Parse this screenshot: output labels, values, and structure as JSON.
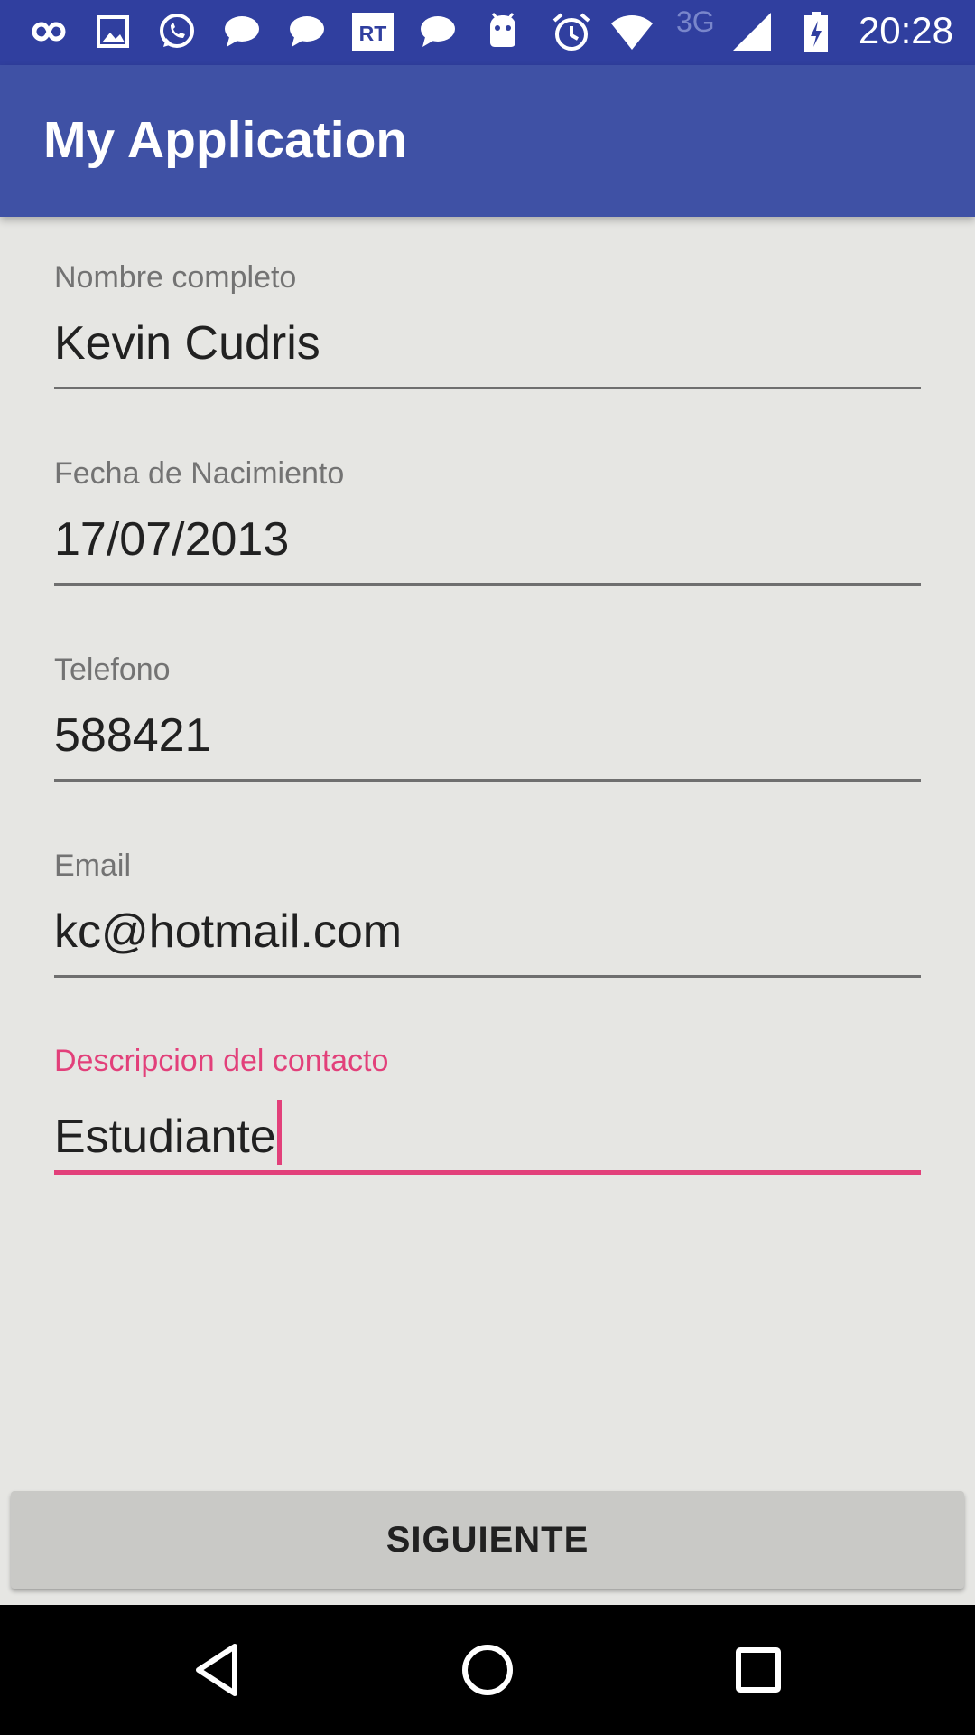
{
  "status_bar": {
    "icons": [
      "infinity-icon",
      "image-icon",
      "whatsapp-icon",
      "chat-bubble-icon",
      "chat-bubble-icon",
      "rt-news-icon",
      "chat-bubble-icon",
      "android-icon",
      "alarm-icon",
      "wifi-icon",
      "cell-signal-icon",
      "battery-charging-icon"
    ],
    "network": "3G",
    "time": "20:28"
  },
  "app_bar": {
    "title": "My Application"
  },
  "form": {
    "fields": [
      {
        "label": "Nombre completo",
        "value": "Kevin Cudris",
        "focused": false
      },
      {
        "label": "Fecha de Nacimiento",
        "value": "17/07/2013",
        "focused": false
      },
      {
        "label": "Telefono",
        "value": "588421",
        "focused": false
      },
      {
        "label": "Email",
        "value": "kc@hotmail.com",
        "focused": false
      },
      {
        "label": "Descripcion del contacto",
        "value": "Estudiante",
        "focused": true
      }
    ]
  },
  "button": {
    "label": "SIGUIENTE"
  },
  "nav_bar": {
    "buttons": [
      "back-icon",
      "home-icon",
      "recents-icon"
    ]
  },
  "colors": {
    "status_bar": "#303f9f",
    "app_bar": "#3f51a5",
    "accent": "#e2407a",
    "background": "#e6e6e3"
  }
}
